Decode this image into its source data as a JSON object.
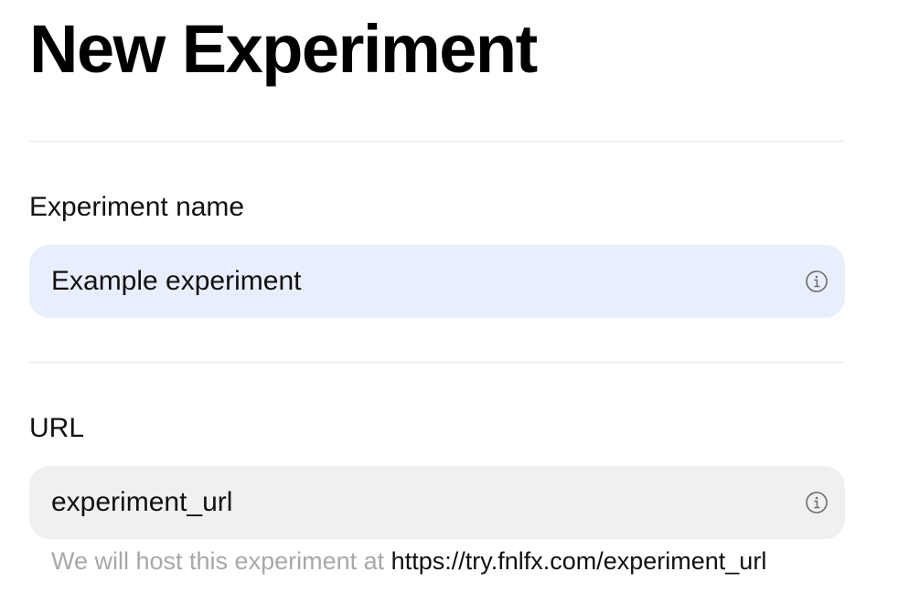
{
  "page": {
    "title": "New Experiment"
  },
  "form": {
    "name_field": {
      "label": "Experiment name",
      "value": "Example experiment",
      "info_icon": "info-icon",
      "background_color": "#e8eefc"
    },
    "url_field": {
      "label": "URL",
      "value": "experiment_url",
      "info_icon": "info-icon",
      "background_color": "#f0f0f0"
    },
    "hint": {
      "text": "We will host this experiment at",
      "url": "https://try.fnlfx.com/experiment_url"
    }
  }
}
